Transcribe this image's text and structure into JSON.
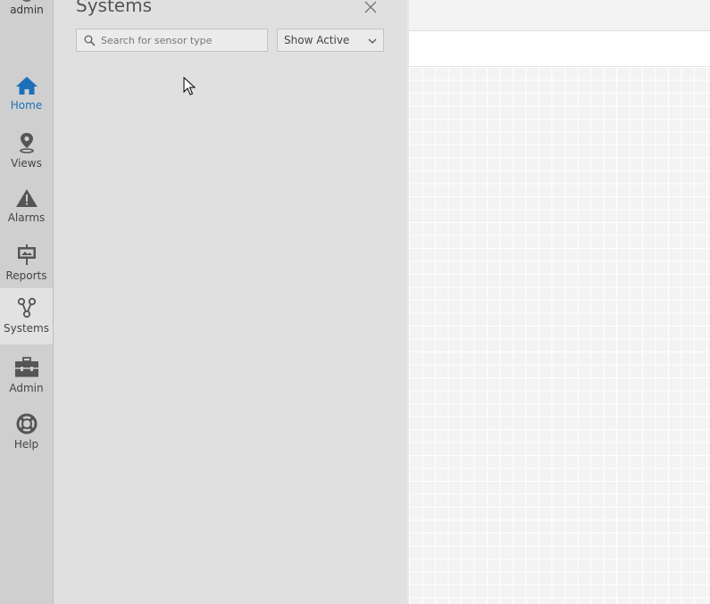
{
  "user": {
    "name": "admin"
  },
  "nav": {
    "items": [
      {
        "label": "Home",
        "icon": "home-icon"
      },
      {
        "label": "Views",
        "icon": "map-pin-icon"
      },
      {
        "label": "Alarms",
        "icon": "warning-icon"
      },
      {
        "label": "Reports",
        "icon": "presentation-icon"
      },
      {
        "label": "Systems",
        "icon": "systems-icon"
      },
      {
        "label": "Admin",
        "icon": "toolbox-icon"
      },
      {
        "label": "Help",
        "icon": "lifebuoy-icon"
      }
    ],
    "active": "Systems",
    "accent_color": "#1d6fb8"
  },
  "panel": {
    "title": "Systems",
    "search_placeholder": "Search for sensor type",
    "filter_value": "Show Active"
  }
}
